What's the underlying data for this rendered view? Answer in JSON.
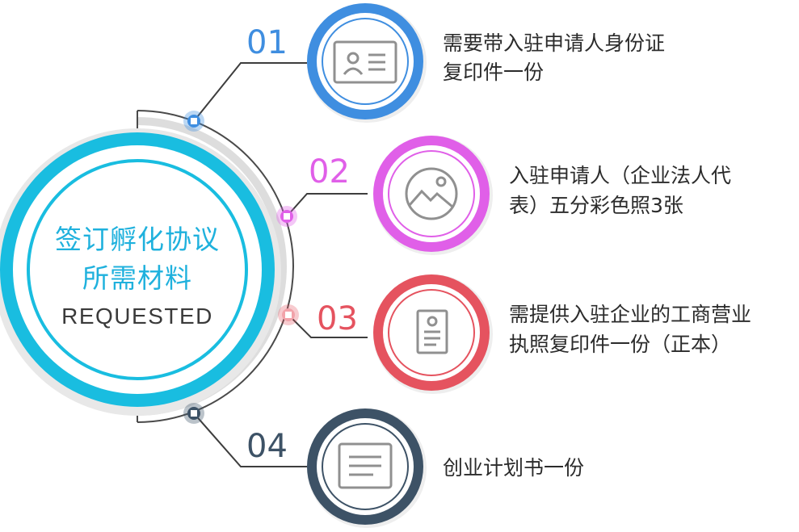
{
  "hub": {
    "title_line1": "签订孵化协议",
    "title_line2": "所需材料",
    "subtitle": "REQUESTED",
    "color": "#19bde0"
  },
  "items": [
    {
      "number": "01",
      "text_line1": "需要带入驻申请人身份证",
      "text_line2": "复印件一份",
      "color": "#3f8ee0",
      "icon": "id-card-icon"
    },
    {
      "number": "02",
      "text_line1": "入驻申请人（企业法人代",
      "text_line2": "表）五分彩色照3张",
      "color": "#e05fe8",
      "icon": "picture-icon"
    },
    {
      "number": "03",
      "text_line1": "需提供入驻企业的工商营业",
      "text_line2": "执照复印件一份（正本）",
      "color": "#e5535f",
      "icon": "license-document-icon"
    },
    {
      "number": "04",
      "text_line1": "创业计划书一份",
      "text_line2": "",
      "color": "#3d5266",
      "icon": "plan-document-icon"
    }
  ]
}
